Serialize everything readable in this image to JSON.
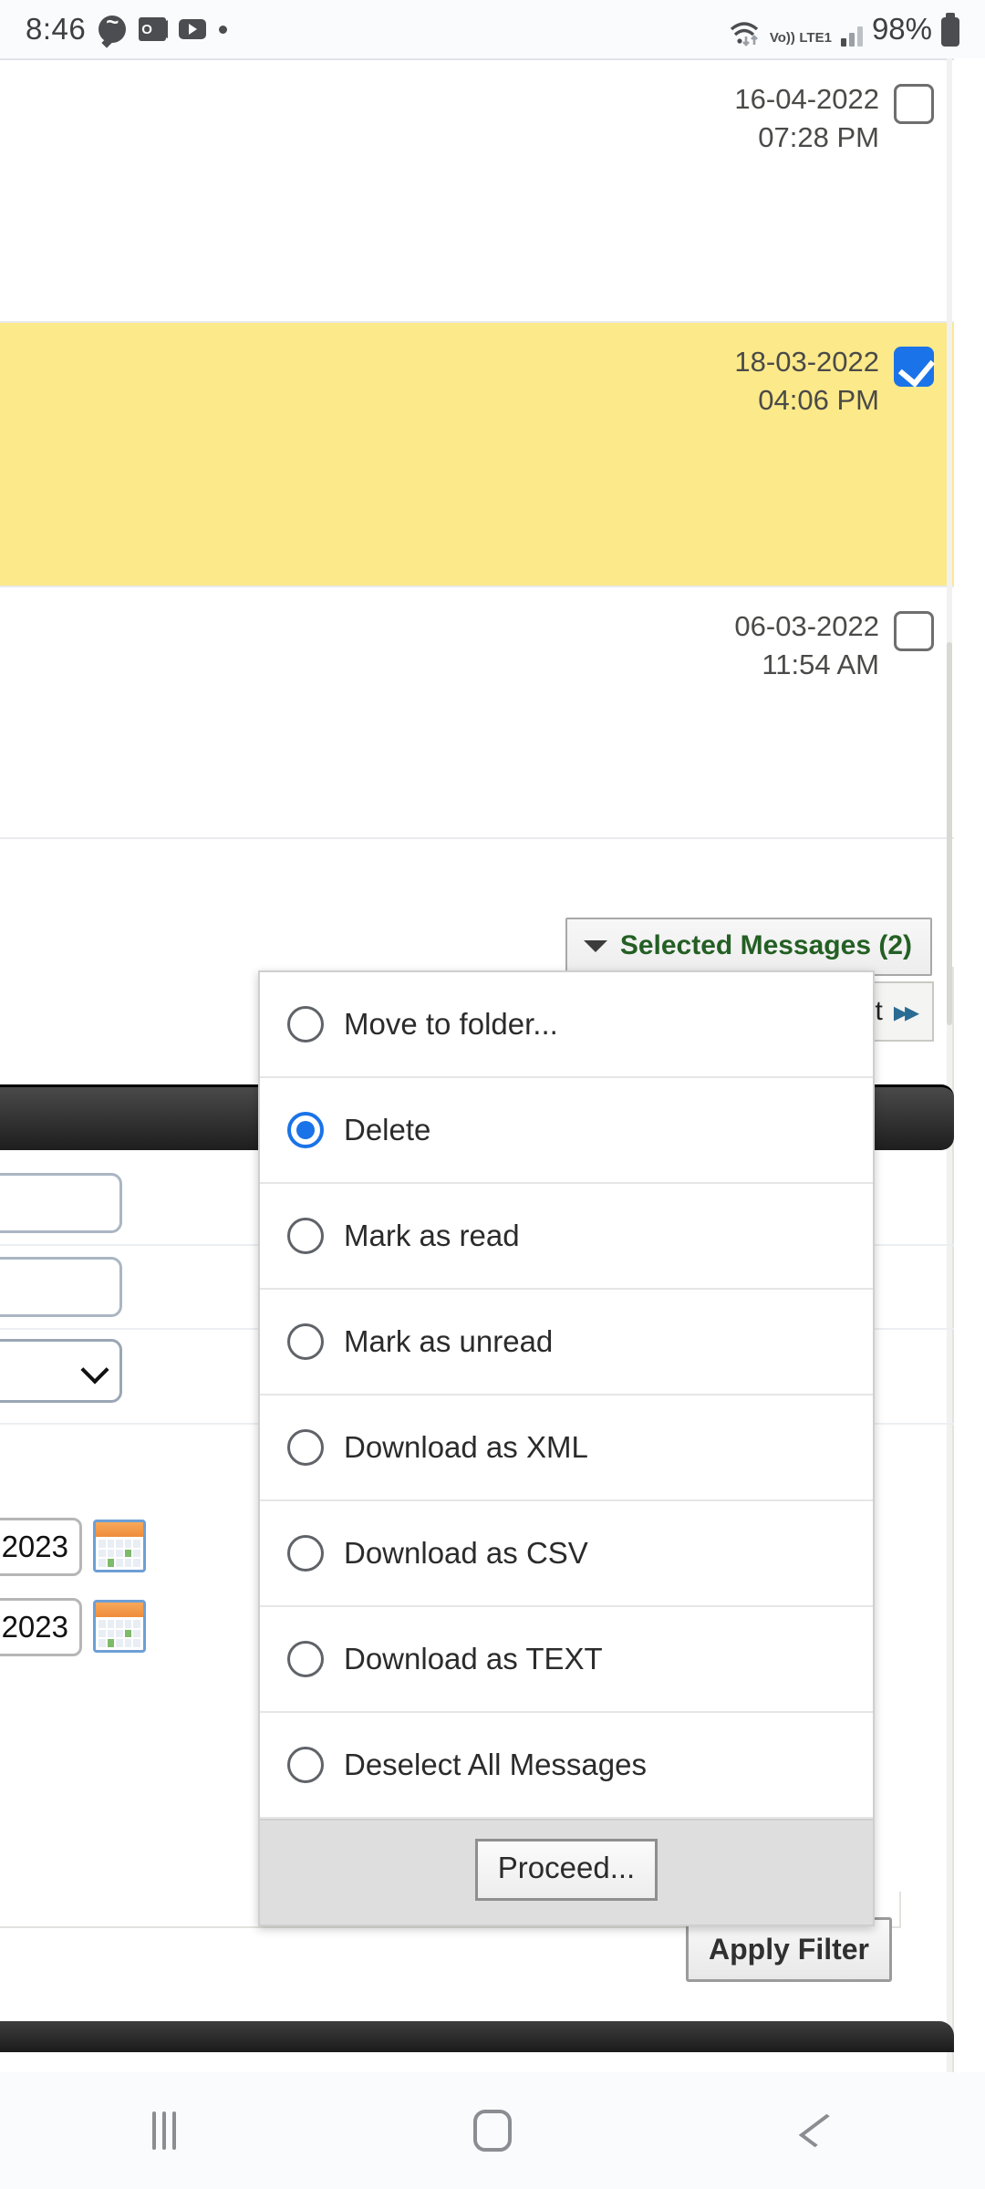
{
  "status_bar": {
    "time": "8:46",
    "icons": [
      "messenger-icon",
      "outlook-icon",
      "youtube-icon",
      "notification-dot"
    ],
    "network_label": "Vo)) LTE1",
    "volte_line1": "Vo))",
    "volte_line2": "LTE1",
    "battery_percent": "98%",
    "wifi_icon": "wifi-icon",
    "signal_icon": "signal-bars-icon",
    "battery_icon": "battery-icon"
  },
  "message_list": {
    "rows": [
      {
        "date": "16-04-2022",
        "time": "07:28 PM",
        "selected": false,
        "highlighted": false
      },
      {
        "date": "18-03-2022",
        "time": "04:06 PM",
        "selected": true,
        "highlighted": true
      },
      {
        "date": "06-03-2022",
        "time": "11:54 AM",
        "selected": false,
        "highlighted": false
      }
    ]
  },
  "toolbar": {
    "selected_messages_label": "Selected Messages (2)",
    "selected_count": 2,
    "dropdown_caret": "caret-down-icon",
    "pager_label": "st",
    "pager_full_label": "Last",
    "pager_next_icon": "double-chevron-right-icon"
  },
  "dropdown_menu": {
    "selected_option": "Delete",
    "options": [
      {
        "label": "Move to folder...",
        "selected": false
      },
      {
        "label": "Delete",
        "selected": true
      },
      {
        "label": "Mark as read",
        "selected": false
      },
      {
        "label": "Mark as unread",
        "selected": false
      },
      {
        "label": "Download as XML",
        "selected": false
      },
      {
        "label": "Download as CSV",
        "selected": false
      },
      {
        "label": "Download as TEXT",
        "selected": false
      },
      {
        "label": "Deselect All Messages",
        "selected": false
      }
    ],
    "proceed_label": "Proceed..."
  },
  "filter_panel": {
    "text_field_1_value": "",
    "text_field_2_value": "",
    "select_value": "",
    "select_icon": "chevron-down-icon",
    "date_from_value": "2023",
    "date_to_value": "2023",
    "calendar_icon": "calendar-picker-icon",
    "apply_filter_label": "Apply Filter"
  },
  "nav_bar": {
    "recents": "recents-icon",
    "home": "home-icon",
    "back": "back-icon"
  },
  "colors": {
    "highlight_row": "#fce98a",
    "accent_blue": "#1a73e8",
    "selected_text_green": "#245f24",
    "menu_footer_gray": "#dedede",
    "page_bg": "#ffffff"
  }
}
